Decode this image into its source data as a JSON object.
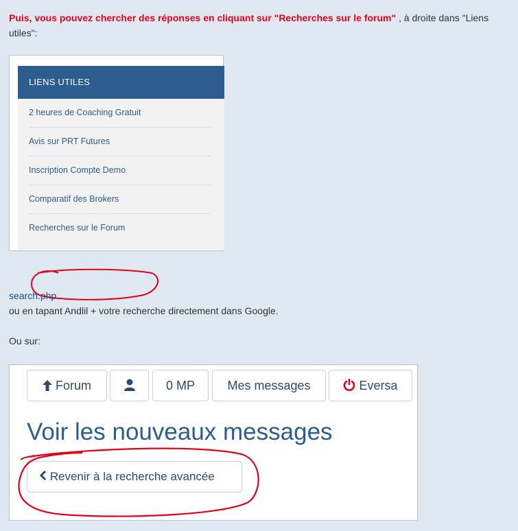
{
  "post": {
    "intro_highlight": "Puis, vous pouvez chercher des réponses en cliquant sur \"Recherches sur le forum\"",
    "intro_rest": " , à droite dans \"Liens",
    "intro_cont": "utiles\":",
    "search_link": "search.php",
    "google_text": "ou en tapant Andlil + votre recherche directement dans Google.",
    "ou_sur": "Ou sur:"
  },
  "liens_utiles": {
    "header": "LIENS UTILES",
    "items": [
      "2 heures de Coaching Gratuit",
      "Avis sur PRT Futures",
      "Inscription Compte Demo",
      "Comparatif des Brokers",
      "Recherches sur le Forum"
    ]
  },
  "forum_nav": {
    "forum_label": "Forum",
    "mp_label": "0 MP",
    "messages_label": "Mes messages",
    "user_label": "Eversa",
    "page_title": "Voir les nouveaux messages",
    "back_button": "Revenir à la recherche avancée"
  },
  "colors": {
    "highlight": "#e8001c",
    "panel_header": "#2d5d8e",
    "link": "#2d5d8e",
    "annotation": "#e4001b"
  },
  "icons": [
    "arrow-up-icon",
    "user-icon",
    "power-icon",
    "chevron-left-icon"
  ]
}
